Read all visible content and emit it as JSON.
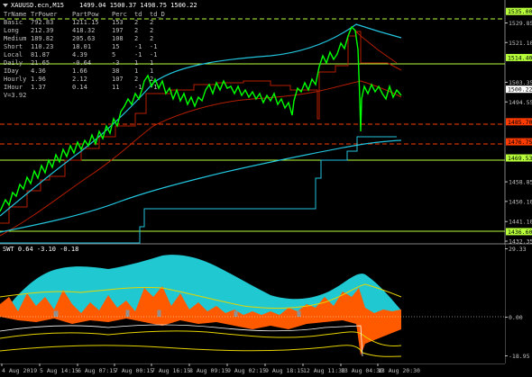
{
  "header": {
    "symbol": "XAUUSD.ecn,M15",
    "ohlc": "1499.04 1500.37 1498.75 1500.22"
  },
  "table": {
    "headers": [
      "TrName",
      "TrPower",
      "PartPow",
      "Perc",
      "td",
      "td_D"
    ],
    "rows": [
      [
        "Basic",
        "792.83",
        "1211.15",
        "153",
        "2",
        "2"
      ],
      [
        "Long",
        "212.39",
        "418.32",
        "197",
        "2",
        "2"
      ],
      [
        "Medium",
        "189.82",
        "205.63",
        "108",
        "2",
        "2"
      ],
      [
        "Short",
        "110.23",
        "18.01",
        "15",
        "-1",
        "-1"
      ],
      [
        "Local",
        "81.87",
        "4.39",
        "5",
        "-1",
        "-1"
      ],
      [
        "Daily",
        "21.65",
        "-0.64",
        "-3",
        "1",
        "1"
      ],
      [
        "IDay",
        "4.36",
        "1.66",
        "38",
        "1",
        "1"
      ],
      [
        "Hourly",
        "1.96",
        "2.12",
        "107",
        "2",
        "2"
      ],
      [
        "IHour",
        "1.37",
        "0.14",
        "11",
        "-1",
        "-1"
      ]
    ],
    "extra": "V=3.92"
  },
  "price_axis": {
    "labels": [
      "1535.00",
      "1529.85",
      "1521.10",
      "1514.40",
      "1503.35",
      "1500.22",
      "1494.55",
      "1485.70",
      "1476.75",
      "1469.53",
      "1458.85",
      "1450.10",
      "1441.10",
      "1436.60",
      "1432.35"
    ],
    "badges": [
      {
        "value": "1535.00",
        "color": "#b6ff3a",
        "text_color": "#000000"
      },
      {
        "value": "1514.40",
        "color": "#b6ff3a",
        "text_color": "#000000"
      },
      {
        "value": "1500.22",
        "color": "#ffffff",
        "text_color": "#000000"
      },
      {
        "value": "1485.70",
        "color": "#ff3b00",
        "text_color": "#000000"
      },
      {
        "value": "1476.75",
        "color": "#ff3b00",
        "text_color": "#000000"
      },
      {
        "value": "1469.53",
        "color": "#b6ff3a",
        "text_color": "#000000"
      },
      {
        "value": "1436.60",
        "color": "#b6ff3a",
        "text_color": "#000000"
      }
    ]
  },
  "indicator": {
    "label": "SWT 0.64 -3.10 -0.18",
    "axis_labels": [
      "29.33",
      "0.00",
      "-18.95"
    ]
  },
  "time_axis": {
    "labels": [
      "4 Aug 2019",
      "5 Aug 14:15",
      "6 Aug 07:15",
      "7 Aug 00:15",
      "7 Aug 16:15",
      "8 Aug 09:15",
      "9 Aug 02:15",
      "9 Aug 18:15",
      "12 Aug 11:30",
      "13 Aug 04:30",
      "13 Aug 20:30"
    ]
  },
  "colors": {
    "price": "#00ff00",
    "band_cyan": "#22c3dc",
    "band_red": "#b41e00",
    "level_green": "#b6ff3a",
    "level_red": "#ff3b00",
    "osc_cyan": "#20c8d2",
    "osc_orange": "#ff5a00",
    "osc_yellow": "#e6d400"
  }
}
